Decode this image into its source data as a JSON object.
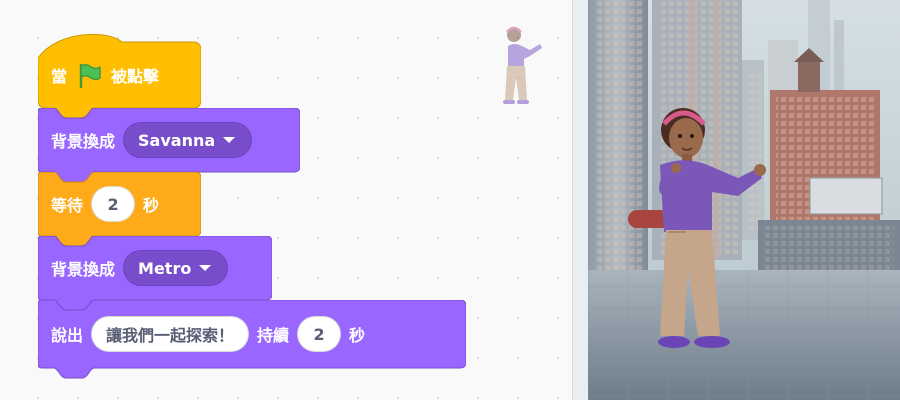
{
  "script": {
    "hat_when": "當",
    "hat_clicked": "被點擊",
    "switch_backdrop_1": {
      "label": "背景換成",
      "value": "Savanna"
    },
    "wait": {
      "label": "等待",
      "seconds": "2",
      "unit": "秒"
    },
    "switch_backdrop_2": {
      "label": "背景換成",
      "value": "Metro"
    },
    "say_for": {
      "label": "說出",
      "message": "讓我們一起探索！",
      "for_label": "持續",
      "seconds": "2",
      "unit": "秒"
    }
  },
  "icons": {
    "green_flag": "green-flag-icon",
    "dropdown": "dropdown-caret-icon"
  },
  "colors": {
    "events": "#ffbf00",
    "control": "#ffab19",
    "looks": "#9966ff",
    "looks_dark": "#774dcb",
    "flag": "#4cbf56"
  }
}
